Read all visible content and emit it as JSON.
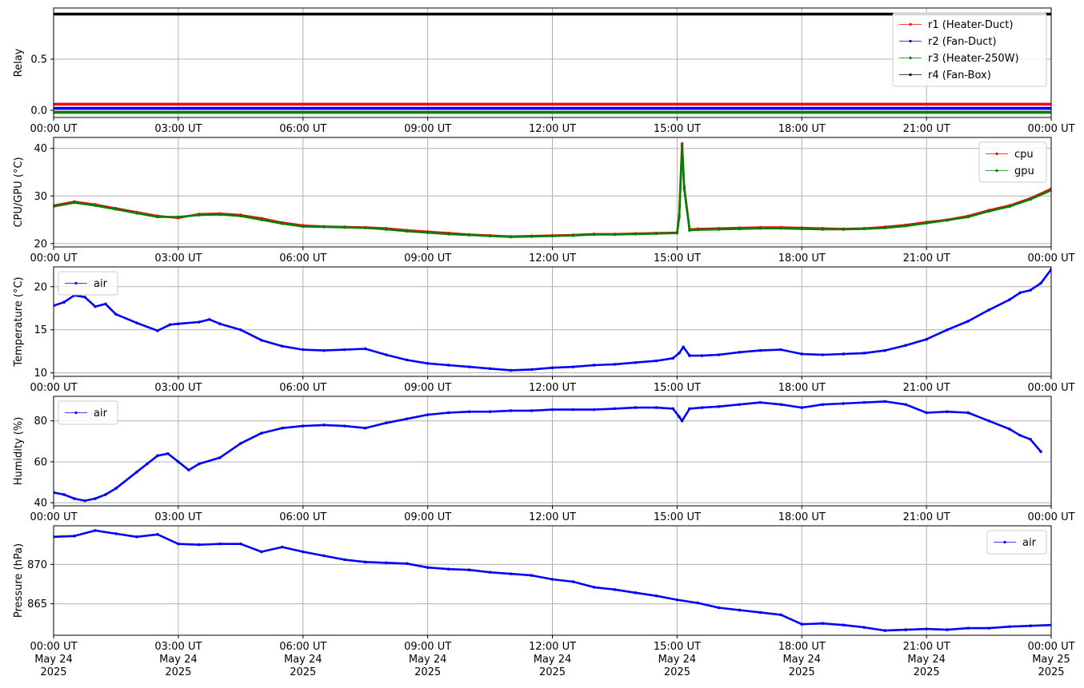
{
  "chart_data": [
    {
      "type": "line",
      "id": "relay",
      "ylabel": "Relay",
      "ylim": [
        -0.07,
        1.0
      ],
      "yticks": [
        0.0,
        0.5
      ],
      "ytick_labels": [
        "0.0",
        "0.5"
      ],
      "grid": true,
      "legend": "top-right",
      "series": [
        {
          "name": "r1 (Heater-Duct)",
          "color": "#ff0000",
          "constant": 0.06
        },
        {
          "name": "r2 (Fan-Duct)",
          "color": "#0000ff",
          "constant": 0.02
        },
        {
          "name": "r3 (Heater-250W)",
          "color": "#008000",
          "constant": -0.02
        },
        {
          "name": "r4 (Fan-Box)",
          "color": "#000000",
          "constant": 0.94
        }
      ]
    },
    {
      "type": "line",
      "id": "cpu-gpu",
      "ylabel": "CPU/GPU (°C)",
      "ylim": [
        19.3,
        42.3
      ],
      "yticks": [
        20,
        30,
        40
      ],
      "ytick_labels": [
        "20",
        "30",
        "40"
      ],
      "grid": true,
      "legend": "top-right",
      "x": [
        0,
        0.5,
        1,
        1.5,
        2,
        2.5,
        3,
        3.5,
        4,
        4.5,
        5,
        5.5,
        6,
        6.5,
        7,
        7.5,
        8,
        8.5,
        9,
        9.5,
        10,
        10.5,
        11,
        11.5,
        12,
        12.5,
        13,
        13.5,
        14,
        14.5,
        15,
        15.05,
        15.12,
        15.17,
        15.3,
        15.5,
        16,
        16.5,
        17,
        17.5,
        18,
        18.5,
        19,
        19.5,
        20,
        20.5,
        21,
        21.5,
        22,
        22.5,
        23,
        23.5,
        24
      ],
      "series": [
        {
          "name": "cpu",
          "color": "#ff0000",
          "values": [
            28,
            28.8,
            28.2,
            27.4,
            26.6,
            25.8,
            25.4,
            26.2,
            26.3,
            26,
            25.3,
            24.4,
            23.8,
            23.6,
            23.5,
            23.4,
            23.2,
            22.8,
            22.5,
            22.2,
            21.9,
            21.7,
            21.5,
            21.6,
            21.7,
            21.8,
            22,
            22,
            22.1,
            22.2,
            22.3,
            26,
            41,
            32,
            23,
            23.1,
            23.2,
            23.3,
            23.4,
            23.4,
            23.3,
            23.2,
            23.1,
            23.2,
            23.5,
            23.9,
            24.5,
            25,
            25.8,
            27,
            28,
            29.5,
            31.5
          ]
        },
        {
          "name": "gpu",
          "color": "#008000",
          "values": [
            27.8,
            28.6,
            28,
            27.2,
            26.4,
            25.6,
            25.6,
            26,
            26.1,
            25.8,
            25,
            24.2,
            23.6,
            23.5,
            23.4,
            23.3,
            23,
            22.6,
            22.3,
            22,
            21.8,
            21.6,
            21.4,
            21.5,
            21.6,
            21.7,
            21.9,
            21.9,
            22,
            22.1,
            22.2,
            25.5,
            40.5,
            31.5,
            22.8,
            22.9,
            23,
            23.1,
            23.2,
            23.2,
            23.1,
            23,
            23,
            23.1,
            23.3,
            23.7,
            24.3,
            24.9,
            25.6,
            26.8,
            27.8,
            29.3,
            31.2
          ]
        }
      ]
    },
    {
      "type": "line",
      "id": "temperature",
      "ylabel": "Temperature (°C)",
      "ylim": [
        9.6,
        22.3
      ],
      "yticks": [
        10,
        15,
        20
      ],
      "ytick_labels": [
        "10",
        "15",
        "20"
      ],
      "grid": true,
      "legend": "top-left",
      "x": [
        0,
        0.25,
        0.5,
        0.75,
        1,
        1.25,
        1.5,
        2,
        2.5,
        2.8,
        3,
        3.5,
        3.75,
        4,
        4.5,
        5,
        5.5,
        6,
        6.5,
        7,
        7.5,
        8,
        8.5,
        9,
        9.5,
        10,
        10.5,
        11,
        11.5,
        12,
        12.5,
        13,
        13.5,
        14,
        14.5,
        14.9,
        15.05,
        15.15,
        15.3,
        15.6,
        16,
        16.5,
        17,
        17.5,
        18,
        18.5,
        19,
        19.5,
        20,
        20.5,
        21,
        21.5,
        22,
        22.5,
        23,
        23.25,
        23.5,
        23.75,
        24
      ],
      "series": [
        {
          "name": "air",
          "color": "#0000ff",
          "values": [
            17.8,
            18.2,
            19,
            18.8,
            17.7,
            18,
            16.8,
            15.8,
            14.9,
            15.6,
            15.7,
            15.9,
            16.2,
            15.7,
            15,
            13.8,
            13.1,
            12.7,
            12.6,
            12.7,
            12.8,
            12.1,
            11.5,
            11.1,
            10.9,
            10.7,
            10.5,
            10.3,
            10.4,
            10.6,
            10.7,
            10.9,
            11,
            11.2,
            11.4,
            11.7,
            12.3,
            13,
            12,
            12,
            12.1,
            12.4,
            12.6,
            12.7,
            12.2,
            12.1,
            12.2,
            12.3,
            12.6,
            13.2,
            13.9,
            15,
            16,
            17.3,
            18.5,
            19.3,
            19.6,
            20.4,
            22
          ]
        }
      ]
    },
    {
      "type": "line",
      "id": "humidity",
      "ylabel": "Humidity (%)",
      "ylim": [
        38.5,
        92
      ],
      "yticks": [
        40,
        60,
        80
      ],
      "ytick_labels": [
        "40",
        "60",
        "80"
      ],
      "grid": true,
      "legend": "top-left",
      "x": [
        0,
        0.25,
        0.5,
        0.75,
        1,
        1.25,
        1.5,
        2,
        2.25,
        2.5,
        2.75,
        3,
        3.25,
        3.5,
        4,
        4.5,
        5,
        5.5,
        6,
        6.5,
        7,
        7.5,
        8,
        8.5,
        9,
        9.5,
        10,
        10.5,
        11,
        11.5,
        12,
        12.5,
        13,
        13.5,
        14,
        14.5,
        14.9,
        15.05,
        15.12,
        15.3,
        15.6,
        16,
        16.5,
        17,
        17.5,
        18,
        18.5,
        19,
        19.5,
        20,
        20.5,
        21,
        21.5,
        22,
        22.5,
        23,
        23.25,
        23.5,
        23.75,
        24
      ],
      "series": [
        {
          "name": "air",
          "color": "#0000ff",
          "values": [
            45,
            44,
            42,
            41,
            42,
            44,
            47,
            55,
            59,
            63,
            64,
            60,
            56,
            59,
            62,
            69,
            74,
            76.5,
            77.5,
            78,
            77.5,
            76.5,
            79,
            81,
            83,
            84,
            84.5,
            84.5,
            85,
            85,
            85.5,
            85.5,
            85.5,
            86,
            86.5,
            86.5,
            86,
            82,
            80,
            86,
            86.5,
            87,
            88,
            89,
            88,
            86.5,
            88,
            88.5,
            89,
            89.5,
            88,
            84,
            84.5,
            84,
            80,
            76,
            73,
            71,
            65
          ]
        }
      ]
    },
    {
      "type": "line",
      "id": "pressure",
      "ylabel": "Pressure (hPa)",
      "ylim": [
        861,
        874.9
      ],
      "yticks": [
        865,
        870
      ],
      "ytick_labels": [
        "865",
        "870"
      ],
      "grid": true,
      "legend": "top-right",
      "x": [
        0,
        0.5,
        1,
        1.5,
        2,
        2.5,
        3,
        3.5,
        4,
        4.5,
        5,
        5.5,
        6,
        6.5,
        7,
        7.5,
        8,
        8.5,
        9,
        9.5,
        10,
        10.5,
        11,
        11.5,
        12,
        12.5,
        13,
        13.5,
        14,
        14.5,
        15,
        15.5,
        16,
        16.5,
        17,
        17.5,
        18,
        18.5,
        19,
        19.5,
        20,
        20.5,
        21,
        21.5,
        22,
        22.5,
        23,
        23.5,
        24
      ],
      "series": [
        {
          "name": "air",
          "color": "#0000ff",
          "values": [
            873.5,
            873.6,
            874.3,
            873.9,
            873.5,
            873.8,
            872.6,
            872.5,
            872.6,
            872.6,
            871.6,
            872.2,
            871.6,
            871.1,
            870.6,
            870.3,
            870.2,
            870.1,
            869.6,
            869.4,
            869.3,
            869,
            868.8,
            868.6,
            868.1,
            867.8,
            867.1,
            866.8,
            866.4,
            866,
            865.5,
            865.1,
            864.5,
            864.2,
            863.9,
            863.6,
            862.4,
            862.5,
            862.3,
            862,
            861.6,
            861.7,
            861.8,
            861.7,
            861.9,
            861.9,
            862.1,
            862.2,
            862.3
          ]
        }
      ]
    }
  ],
  "x_axis": {
    "range_hours": [
      0,
      24
    ],
    "ticks_hours": [
      0,
      3,
      6,
      9,
      12,
      15,
      18,
      21,
      24
    ],
    "tick_labels": [
      "00:00 UT",
      "03:00 UT",
      "06:00 UT",
      "09:00 UT",
      "12:00 UT",
      "15:00 UT",
      "18:00 UT",
      "21:00 UT",
      "00:00 UT"
    ],
    "date_labels": [
      "May 24",
      "May 24",
      "May 24",
      "May 24",
      "May 24",
      "May 24",
      "May 24",
      "May 24",
      "May 25"
    ],
    "year_labels": [
      "2025",
      "2025",
      "2025",
      "2025",
      "2025",
      "2025",
      "2025",
      "2025",
      "2025"
    ]
  }
}
